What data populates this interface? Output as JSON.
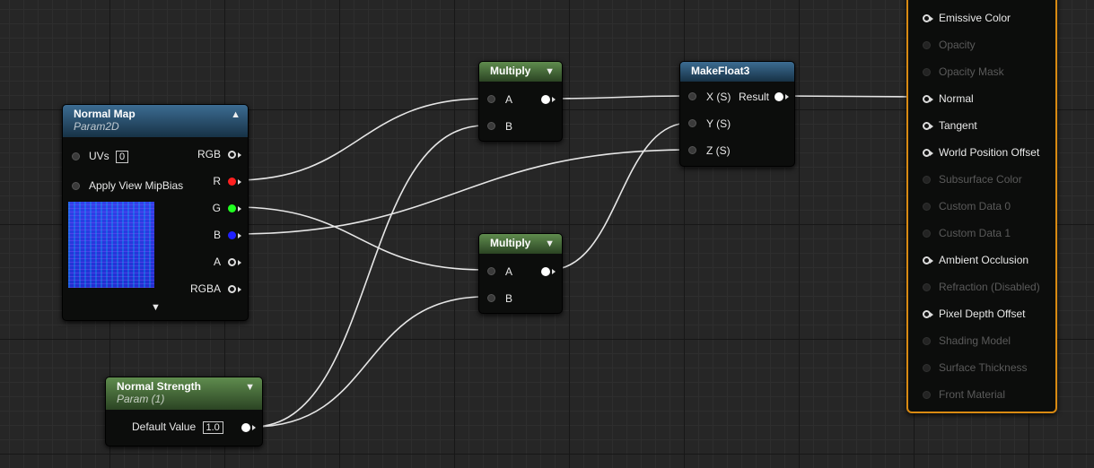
{
  "normal_map": {
    "title": "Normal Map",
    "subtitle": "Param2D",
    "uvs_label": "UVs",
    "uvs_value": "0",
    "mipbias_label": "Apply View MipBias",
    "outputs": [
      "RGB",
      "R",
      "G",
      "B",
      "A",
      "RGBA"
    ]
  },
  "multiply1": {
    "title": "Multiply",
    "input_a": "A",
    "input_b": "B"
  },
  "multiply2": {
    "title": "Multiply",
    "input_a": "A",
    "input_b": "B"
  },
  "makefloat": {
    "title": "MakeFloat3",
    "x": "X (S)",
    "y": "Y (S)",
    "z": "Z (S)",
    "result": "Result"
  },
  "strength": {
    "title": "Normal Strength",
    "subtitle": "Param (1)",
    "default_label": "Default Value",
    "default_value": "1.0"
  },
  "material_inputs": [
    {
      "label": "Emissive Color",
      "enabled": true
    },
    {
      "label": "Opacity",
      "enabled": false
    },
    {
      "label": "Opacity Mask",
      "enabled": false
    },
    {
      "label": "Normal",
      "enabled": true
    },
    {
      "label": "Tangent",
      "enabled": true
    },
    {
      "label": "World Position Offset",
      "enabled": true
    },
    {
      "label": "Subsurface Color",
      "enabled": false
    },
    {
      "label": "Custom Data 0",
      "enabled": false
    },
    {
      "label": "Custom Data 1",
      "enabled": false
    },
    {
      "label": "Ambient Occlusion",
      "enabled": true
    },
    {
      "label": "Refraction (Disabled)",
      "enabled": false
    },
    {
      "label": "Pixel Depth Offset",
      "enabled": true
    },
    {
      "label": "Shading Model",
      "enabled": false
    },
    {
      "label": "Surface Thickness",
      "enabled": false
    },
    {
      "label": "Front Material",
      "enabled": false
    }
  ],
  "colors": {
    "accent": "#d98a12",
    "blue_header": "#2a5575",
    "green_header": "#4c7340"
  }
}
